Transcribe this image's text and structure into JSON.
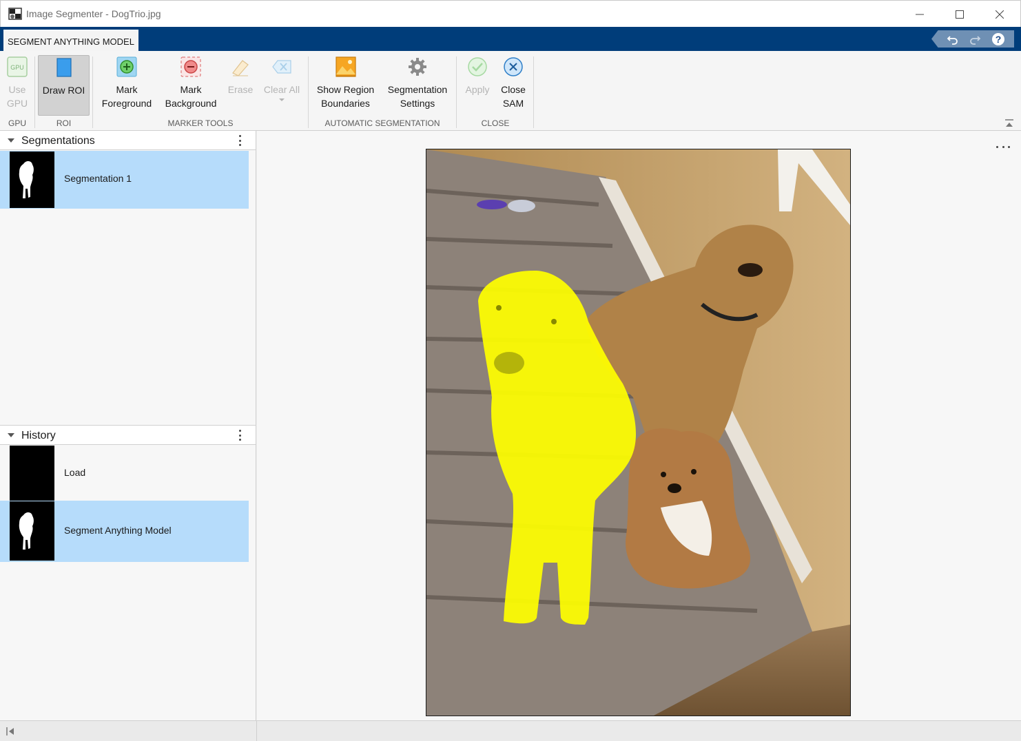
{
  "window": {
    "title": "Image Segmenter - DogTrio.jpg"
  },
  "tabstrip": {
    "active_tab": "SEGMENT ANYTHING MODEL",
    "quick_access": [
      "undo-icon",
      "redo-icon",
      "help-icon"
    ]
  },
  "toolstrip": {
    "gpu": {
      "icon_text": "GPU",
      "label_line1": "Use",
      "label_line2": "GPU",
      "section": "GPU"
    },
    "roi": {
      "label": "Draw ROI",
      "section": "ROI"
    },
    "marker_tools": {
      "mark_foreground_line1": "Mark",
      "mark_foreground_line2": "Foreground",
      "mark_background_line1": "Mark",
      "mark_background_line2": "Background",
      "erase": "Erase",
      "clear_all": "Clear All",
      "section": "MARKER TOOLS"
    },
    "automatic_segmentation": {
      "show_boundaries_line1": "Show Region",
      "show_boundaries_line2": "Boundaries",
      "settings_line1": "Segmentation",
      "settings_line2": "Settings",
      "section": "AUTOMATIC SEGMENTATION"
    },
    "close": {
      "apply": "Apply",
      "close_sam_line1": "Close",
      "close_sam_line2": "SAM",
      "section": "CLOSE"
    }
  },
  "segmentations_panel": {
    "title": "Segmentations",
    "items": [
      {
        "label": "Segmentation 1"
      }
    ]
  },
  "history_panel": {
    "title": "History",
    "items": [
      {
        "label": "Load"
      },
      {
        "label": "Segment Anything Model"
      }
    ]
  },
  "colors": {
    "tabstrip_bg": "#003d7a",
    "selected_row": "#b6dcfb",
    "mask_overlay": "#ffff00"
  }
}
